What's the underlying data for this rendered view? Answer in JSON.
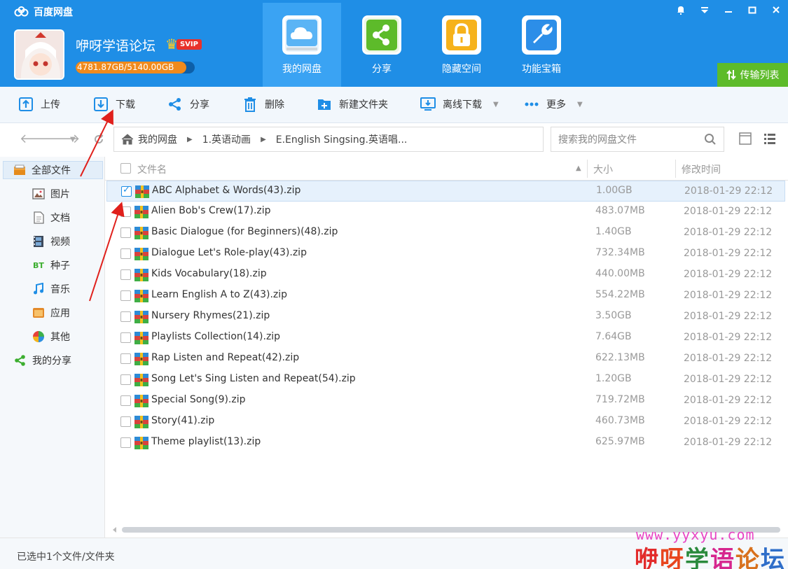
{
  "app": {
    "title": "百度网盘"
  },
  "user": {
    "name": "咿呀学语论坛",
    "vip_badge": "SVIP",
    "quota_text": "4781.87GB/5140.00GB",
    "quota_fraction": 0.93
  },
  "nav_tabs": [
    {
      "label": "我的网盘",
      "active": true
    },
    {
      "label": "分享"
    },
    {
      "label": "隐藏空间"
    },
    {
      "label": "功能宝箱"
    }
  ],
  "transfer_label": "传输列表",
  "toolbar": {
    "upload": "上传",
    "download": "下载",
    "share": "分享",
    "delete": "删除",
    "new_folder": "新建文件夹",
    "offline_download": "离线下载",
    "more": "更多"
  },
  "breadcrumb": [
    "我的网盘",
    "1.英语动画",
    "E.English Singsing.英语唱..."
  ],
  "search_placeholder": "搜索我的网盘文件",
  "sidebar": [
    {
      "label": "全部文件"
    },
    {
      "label": "图片"
    },
    {
      "label": "文档"
    },
    {
      "label": "视频"
    },
    {
      "label": "种子"
    },
    {
      "label": "音乐"
    },
    {
      "label": "应用"
    },
    {
      "label": "其他"
    },
    {
      "label": "我的分享"
    }
  ],
  "bt_icon_text": "BT",
  "columns": {
    "name": "文件名",
    "size": "大小",
    "modified": "修改时间"
  },
  "files": [
    {
      "name": "ABC Alphabet & Words(43).zip",
      "size": "1.00GB",
      "time": "2018-01-29 22:12",
      "checked": true
    },
    {
      "name": "Alien Bob's Crew(17).zip",
      "size": "483.07MB",
      "time": "2018-01-29 22:12"
    },
    {
      "name": "Basic Dialogue (for Beginners)(48).zip",
      "size": "1.40GB",
      "time": "2018-01-29 22:12"
    },
    {
      "name": "Dialogue  Let's Role-play(43).zip",
      "size": "732.34MB",
      "time": "2018-01-29 22:12"
    },
    {
      "name": "Kids Vocabulary(18).zip",
      "size": "440.00MB",
      "time": "2018-01-29 22:12"
    },
    {
      "name": "Learn English A to Z(43).zip",
      "size": "554.22MB",
      "time": "2018-01-29 22:12"
    },
    {
      "name": "Nursery Rhymes(21).zip",
      "size": "3.50GB",
      "time": "2018-01-29 22:12"
    },
    {
      "name": "Playlists Collection(14).zip",
      "size": "7.64GB",
      "time": "2018-01-29 22:12"
    },
    {
      "name": "Rap Listen and Repeat(42).zip",
      "size": "622.13MB",
      "time": "2018-01-29 22:12"
    },
    {
      "name": "Song  Let's Sing  Listen and Repeat(54).zip",
      "size": "1.20GB",
      "time": "2018-01-29 22:12"
    },
    {
      "name": "Special Song(9).zip",
      "size": "719.72MB",
      "time": "2018-01-29 22:12"
    },
    {
      "name": "Story(41).zip",
      "size": "460.73MB",
      "time": "2018-01-29 22:12"
    },
    {
      "name": "Theme playlist(13).zip",
      "size": "625.97MB",
      "time": "2018-01-29 22:12"
    }
  ],
  "status": "已选中1个文件/文件夹",
  "watermark": {
    "url": "www.yyxyu.com",
    "text": "咿呀学语论坛"
  },
  "colors": {
    "header": "#1f8ee6",
    "active_tab": "#3aa3f3",
    "transfer": "#5dbb2a",
    "arrow": "#e0201c"
  }
}
